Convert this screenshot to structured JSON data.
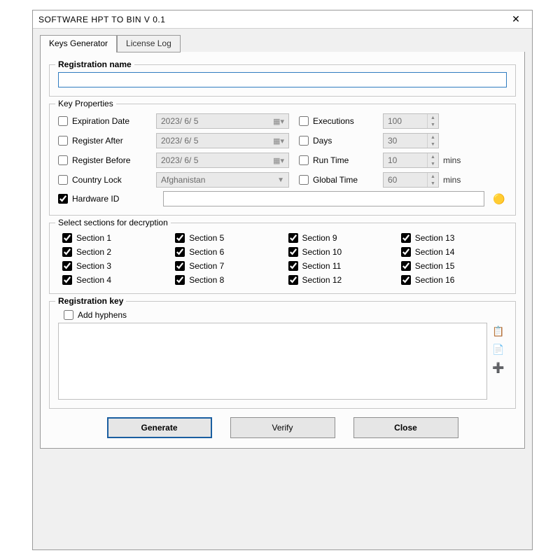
{
  "window": {
    "title": "SOFTWARE HPT TO BIN  V 0.1"
  },
  "tabs": {
    "keys": "Keys Generator",
    "log": "License Log"
  },
  "regname": {
    "label": "Registration name",
    "value": ""
  },
  "keyprops": {
    "title": "Key Properties",
    "expiration": {
      "label": "Expiration Date",
      "checked": false,
      "value": "2023/ 6/ 5"
    },
    "regafter": {
      "label": "Register After",
      "checked": false,
      "value": "2023/ 6/ 5"
    },
    "regbefore": {
      "label": "Register Before",
      "checked": false,
      "value": "2023/ 6/ 5"
    },
    "country": {
      "label": "Country Lock",
      "checked": false,
      "value": "Afghanistan"
    },
    "hwid": {
      "label": "Hardware ID",
      "checked": true,
      "value": ""
    },
    "executions": {
      "label": "Executions",
      "checked": false,
      "value": "100"
    },
    "days": {
      "label": "Days",
      "checked": false,
      "value": "30"
    },
    "runtime": {
      "label": "Run Time",
      "checked": false,
      "value": "10",
      "unit": "mins"
    },
    "globaltime": {
      "label": "Global Time",
      "checked": false,
      "value": "60",
      "unit": "mins"
    }
  },
  "sections": {
    "title": "Select sections for decryption",
    "items": [
      {
        "label": "Section 1",
        "checked": true
      },
      {
        "label": "Section 2",
        "checked": true
      },
      {
        "label": "Section 3",
        "checked": true
      },
      {
        "label": "Section 4",
        "checked": true
      },
      {
        "label": "Section 5",
        "checked": true
      },
      {
        "label": "Section 6",
        "checked": true
      },
      {
        "label": "Section 7",
        "checked": true
      },
      {
        "label": "Section 8",
        "checked": true
      },
      {
        "label": "Section 9",
        "checked": true
      },
      {
        "label": "Section 10",
        "checked": true
      },
      {
        "label": "Section 11",
        "checked": true
      },
      {
        "label": "Section 12",
        "checked": true
      },
      {
        "label": "Section 13",
        "checked": true
      },
      {
        "label": "Section 14",
        "checked": true
      },
      {
        "label": "Section 15",
        "checked": true
      },
      {
        "label": "Section 16",
        "checked": true
      }
    ]
  },
  "regkey": {
    "title": "Registration key",
    "addhyphens": {
      "label": "Add hyphens",
      "checked": false
    },
    "value": ""
  },
  "buttons": {
    "generate": "Generate",
    "verify": "Verify",
    "close": "Close"
  }
}
